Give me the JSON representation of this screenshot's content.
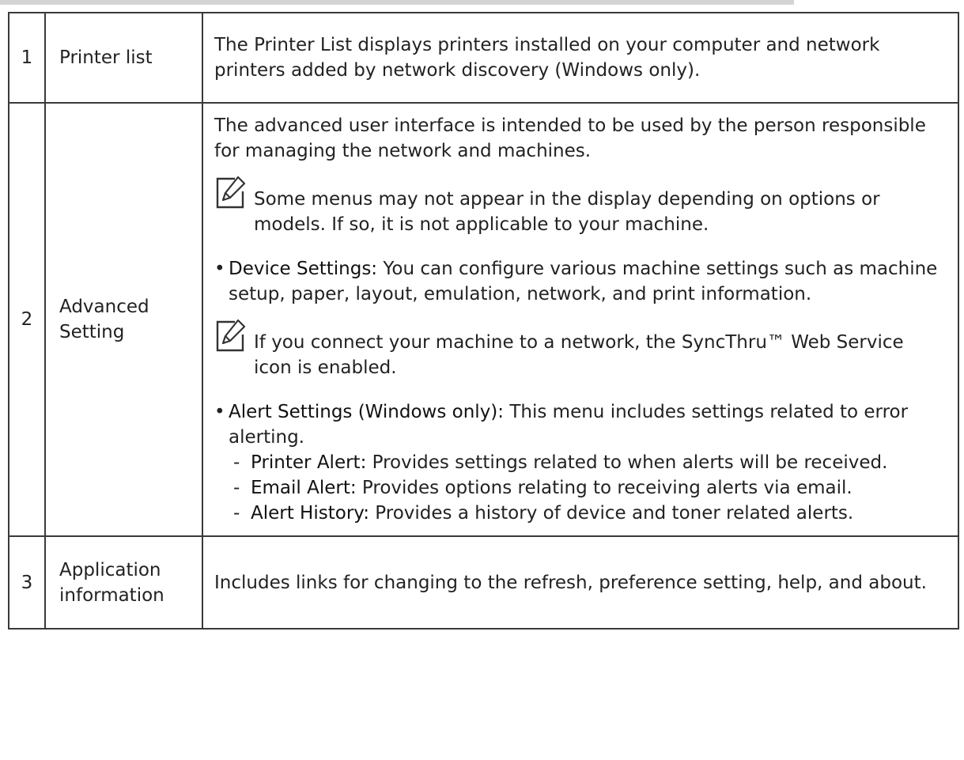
{
  "rows": [
    {
      "number": "1",
      "name": "Printer list",
      "description": "The Printer List displays printers installed on your computer and network printers added by network discovery (Windows only)."
    },
    {
      "number": "2",
      "name": "Advanced Setting",
      "intro": "The advanced user interface is intended to be used by the person responsible for managing the network and machines.",
      "note1": "Some menus may not appear in the display depending on options or models. If so, it is not applicable to your machine.",
      "device_settings_term": "Device Settings:",
      "device_settings_text": " You can configure various machine settings such as machine setup, paper, layout, emulation, network, and print information.",
      "note2": "If you connect your machine to a network, the SyncThru™ Web Service icon is enabled.",
      "alert_settings_term": "Alert Settings (Windows only):",
      "alert_settings_text": " This menu includes settings related to error alerting.",
      "sub_items": [
        {
          "term": "Printer Alert:",
          "text": " Provides settings related to when alerts will be received."
        },
        {
          "term": "Email Alert:",
          "text": " Provides options relating to receiving alerts via email."
        },
        {
          "term": "Alert History:",
          "text": "  Provides a history of device and toner related alerts."
        }
      ]
    },
    {
      "number": "3",
      "name": "Application information",
      "description": "Includes links for changing to the refresh, preference setting, help, and about."
    }
  ],
  "icons": {
    "note": "note-pencil-icon"
  },
  "colors": {
    "border": "#3a3a3a",
    "top_rule": "#d4d4d4",
    "text": "#222222"
  }
}
